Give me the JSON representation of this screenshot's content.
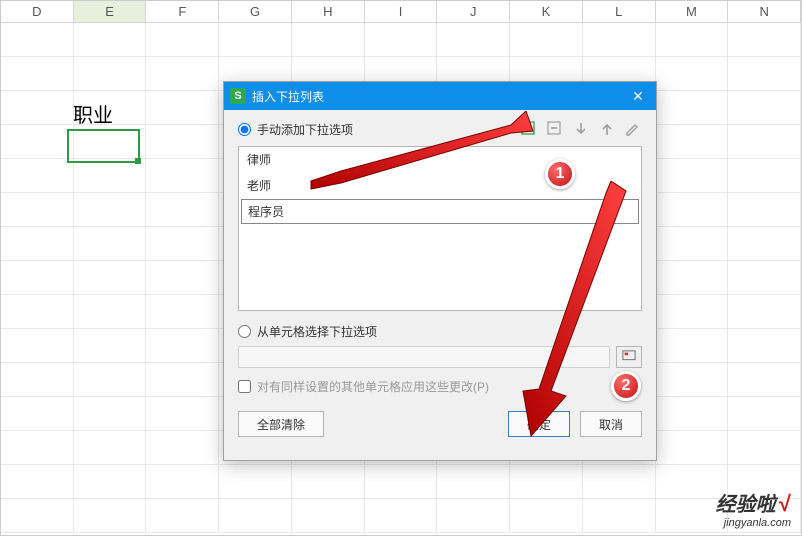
{
  "columns": [
    "D",
    "E",
    "F",
    "G",
    "H",
    "I",
    "J",
    "K",
    "L",
    "M",
    "N"
  ],
  "selected_column_index": 1,
  "sheet": {
    "profession_label": "职业"
  },
  "dialog": {
    "title": "插入下拉列表",
    "manual_label": "手动添加下拉选项",
    "items": [
      "律师",
      "老师",
      "程序员"
    ],
    "editing_index": 2,
    "from_cells_label": "从单元格选择下拉选项",
    "apply_same_label": "对有同样设置的其他单元格应用这些更改(P)",
    "clear_all": "全部清除",
    "ok": "确定",
    "cancel": "取消",
    "radio_selected": "manual"
  },
  "badges": {
    "one": "1",
    "two": "2"
  },
  "watermark": {
    "cn": "经验啦",
    "check": "√",
    "en": "jingyanla.com"
  }
}
